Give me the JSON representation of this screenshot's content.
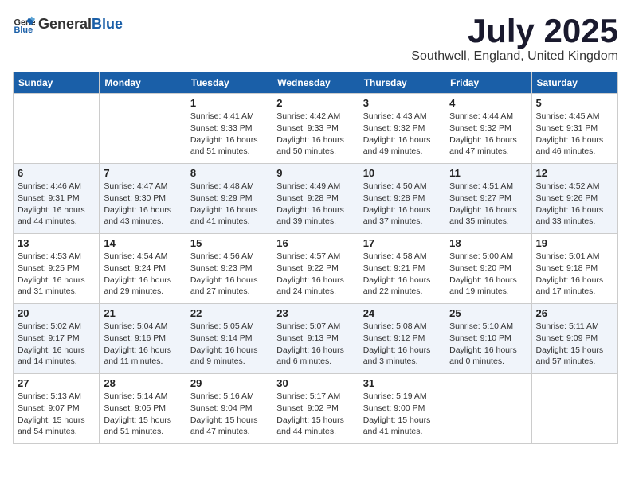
{
  "header": {
    "logo_general": "General",
    "logo_blue": "Blue",
    "month": "July 2025",
    "location": "Southwell, England, United Kingdom"
  },
  "weekdays": [
    "Sunday",
    "Monday",
    "Tuesday",
    "Wednesday",
    "Thursday",
    "Friday",
    "Saturday"
  ],
  "weeks": [
    [
      {
        "day": "",
        "sunrise": "",
        "sunset": "",
        "daylight": ""
      },
      {
        "day": "",
        "sunrise": "",
        "sunset": "",
        "daylight": ""
      },
      {
        "day": "1",
        "sunrise": "Sunrise: 4:41 AM",
        "sunset": "Sunset: 9:33 PM",
        "daylight": "Daylight: 16 hours and 51 minutes."
      },
      {
        "day": "2",
        "sunrise": "Sunrise: 4:42 AM",
        "sunset": "Sunset: 9:33 PM",
        "daylight": "Daylight: 16 hours and 50 minutes."
      },
      {
        "day": "3",
        "sunrise": "Sunrise: 4:43 AM",
        "sunset": "Sunset: 9:32 PM",
        "daylight": "Daylight: 16 hours and 49 minutes."
      },
      {
        "day": "4",
        "sunrise": "Sunrise: 4:44 AM",
        "sunset": "Sunset: 9:32 PM",
        "daylight": "Daylight: 16 hours and 47 minutes."
      },
      {
        "day": "5",
        "sunrise": "Sunrise: 4:45 AM",
        "sunset": "Sunset: 9:31 PM",
        "daylight": "Daylight: 16 hours and 46 minutes."
      }
    ],
    [
      {
        "day": "6",
        "sunrise": "Sunrise: 4:46 AM",
        "sunset": "Sunset: 9:31 PM",
        "daylight": "Daylight: 16 hours and 44 minutes."
      },
      {
        "day": "7",
        "sunrise": "Sunrise: 4:47 AM",
        "sunset": "Sunset: 9:30 PM",
        "daylight": "Daylight: 16 hours and 43 minutes."
      },
      {
        "day": "8",
        "sunrise": "Sunrise: 4:48 AM",
        "sunset": "Sunset: 9:29 PM",
        "daylight": "Daylight: 16 hours and 41 minutes."
      },
      {
        "day": "9",
        "sunrise": "Sunrise: 4:49 AM",
        "sunset": "Sunset: 9:28 PM",
        "daylight": "Daylight: 16 hours and 39 minutes."
      },
      {
        "day": "10",
        "sunrise": "Sunrise: 4:50 AM",
        "sunset": "Sunset: 9:28 PM",
        "daylight": "Daylight: 16 hours and 37 minutes."
      },
      {
        "day": "11",
        "sunrise": "Sunrise: 4:51 AM",
        "sunset": "Sunset: 9:27 PM",
        "daylight": "Daylight: 16 hours and 35 minutes."
      },
      {
        "day": "12",
        "sunrise": "Sunrise: 4:52 AM",
        "sunset": "Sunset: 9:26 PM",
        "daylight": "Daylight: 16 hours and 33 minutes."
      }
    ],
    [
      {
        "day": "13",
        "sunrise": "Sunrise: 4:53 AM",
        "sunset": "Sunset: 9:25 PM",
        "daylight": "Daylight: 16 hours and 31 minutes."
      },
      {
        "day": "14",
        "sunrise": "Sunrise: 4:54 AM",
        "sunset": "Sunset: 9:24 PM",
        "daylight": "Daylight: 16 hours and 29 minutes."
      },
      {
        "day": "15",
        "sunrise": "Sunrise: 4:56 AM",
        "sunset": "Sunset: 9:23 PM",
        "daylight": "Daylight: 16 hours and 27 minutes."
      },
      {
        "day": "16",
        "sunrise": "Sunrise: 4:57 AM",
        "sunset": "Sunset: 9:22 PM",
        "daylight": "Daylight: 16 hours and 24 minutes."
      },
      {
        "day": "17",
        "sunrise": "Sunrise: 4:58 AM",
        "sunset": "Sunset: 9:21 PM",
        "daylight": "Daylight: 16 hours and 22 minutes."
      },
      {
        "day": "18",
        "sunrise": "Sunrise: 5:00 AM",
        "sunset": "Sunset: 9:20 PM",
        "daylight": "Daylight: 16 hours and 19 minutes."
      },
      {
        "day": "19",
        "sunrise": "Sunrise: 5:01 AM",
        "sunset": "Sunset: 9:18 PM",
        "daylight": "Daylight: 16 hours and 17 minutes."
      }
    ],
    [
      {
        "day": "20",
        "sunrise": "Sunrise: 5:02 AM",
        "sunset": "Sunset: 9:17 PM",
        "daylight": "Daylight: 16 hours and 14 minutes."
      },
      {
        "day": "21",
        "sunrise": "Sunrise: 5:04 AM",
        "sunset": "Sunset: 9:16 PM",
        "daylight": "Daylight: 16 hours and 11 minutes."
      },
      {
        "day": "22",
        "sunrise": "Sunrise: 5:05 AM",
        "sunset": "Sunset: 9:14 PM",
        "daylight": "Daylight: 16 hours and 9 minutes."
      },
      {
        "day": "23",
        "sunrise": "Sunrise: 5:07 AM",
        "sunset": "Sunset: 9:13 PM",
        "daylight": "Daylight: 16 hours and 6 minutes."
      },
      {
        "day": "24",
        "sunrise": "Sunrise: 5:08 AM",
        "sunset": "Sunset: 9:12 PM",
        "daylight": "Daylight: 16 hours and 3 minutes."
      },
      {
        "day": "25",
        "sunrise": "Sunrise: 5:10 AM",
        "sunset": "Sunset: 9:10 PM",
        "daylight": "Daylight: 16 hours and 0 minutes."
      },
      {
        "day": "26",
        "sunrise": "Sunrise: 5:11 AM",
        "sunset": "Sunset: 9:09 PM",
        "daylight": "Daylight: 15 hours and 57 minutes."
      }
    ],
    [
      {
        "day": "27",
        "sunrise": "Sunrise: 5:13 AM",
        "sunset": "Sunset: 9:07 PM",
        "daylight": "Daylight: 15 hours and 54 minutes."
      },
      {
        "day": "28",
        "sunrise": "Sunrise: 5:14 AM",
        "sunset": "Sunset: 9:05 PM",
        "daylight": "Daylight: 15 hours and 51 minutes."
      },
      {
        "day": "29",
        "sunrise": "Sunrise: 5:16 AM",
        "sunset": "Sunset: 9:04 PM",
        "daylight": "Daylight: 15 hours and 47 minutes."
      },
      {
        "day": "30",
        "sunrise": "Sunrise: 5:17 AM",
        "sunset": "Sunset: 9:02 PM",
        "daylight": "Daylight: 15 hours and 44 minutes."
      },
      {
        "day": "31",
        "sunrise": "Sunrise: 5:19 AM",
        "sunset": "Sunset: 9:00 PM",
        "daylight": "Daylight: 15 hours and 41 minutes."
      },
      {
        "day": "",
        "sunrise": "",
        "sunset": "",
        "daylight": ""
      },
      {
        "day": "",
        "sunrise": "",
        "sunset": "",
        "daylight": ""
      }
    ]
  ]
}
